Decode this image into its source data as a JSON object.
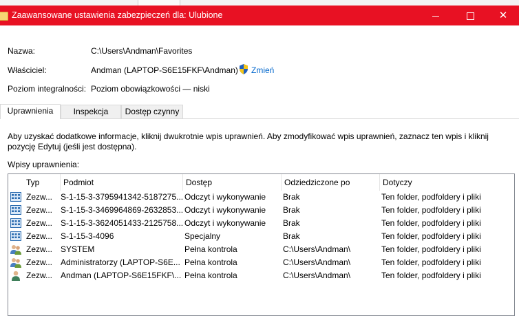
{
  "window": {
    "title": "Zaawansowane ustawienia zabezpieczeń dla: Ulubione"
  },
  "details": {
    "name_label": "Nazwa:",
    "name_value": "C:\\Users\\Andman\\Favorites",
    "owner_label": "Właściciel:",
    "owner_value": "Andman (LAPTOP-S6E15FKF\\Andman)",
    "change_label": "Zmień",
    "integrity_label": "Poziom integralności:",
    "integrity_value": "Poziom obowiązkowości — niski"
  },
  "tabs": [
    {
      "label": "Uprawnienia",
      "active": true
    },
    {
      "label": "Inspekcja",
      "active": false
    },
    {
      "label": "Dostęp czynny",
      "active": false
    }
  ],
  "info_text": "Aby uzyskać dodatkowe informacje, kliknij dwukrotnie wpis uprawnień. Aby zmodyfikować wpis uprawnień, zaznacz ten wpis i kliknij pozycję Edytuj (jeśli jest dostępna).",
  "entries_label": "Wpisy uprawnienia:",
  "table": {
    "columns": [
      "Typ",
      "Podmiot",
      "Dostęp",
      "Odziedziczone po",
      "Dotyczy"
    ],
    "rows": [
      {
        "icon": "app-package-icon",
        "type": "Zezw...",
        "principal": "S-1-15-3-3795941342-5187275...",
        "access": "Odczyt i wykonywanie",
        "inherited": "Brak",
        "applies": "Ten folder, podfoldery i pliki"
      },
      {
        "icon": "app-package-icon",
        "type": "Zezw...",
        "principal": "S-1-15-3-3469964869-2632853...",
        "access": "Odczyt i wykonywanie",
        "inherited": "Brak",
        "applies": "Ten folder, podfoldery i pliki"
      },
      {
        "icon": "app-package-icon",
        "type": "Zezw...",
        "principal": "S-1-15-3-3624051433-2125758...",
        "access": "Odczyt i wykonywanie",
        "inherited": "Brak",
        "applies": "Ten folder, podfoldery i pliki"
      },
      {
        "icon": "app-package-icon",
        "type": "Zezw...",
        "principal": "S-1-15-3-4096",
        "access": "Specjalny",
        "inherited": "Brak",
        "applies": "Ten folder, podfoldery i pliki"
      },
      {
        "icon": "users-group-icon",
        "type": "Zezw...",
        "principal": "SYSTEM",
        "access": "Pełna kontrola",
        "inherited": "C:\\Users\\Andman\\",
        "applies": "Ten folder, podfoldery i pliki"
      },
      {
        "icon": "users-group-icon",
        "type": "Zezw...",
        "principal": "Administratorzy (LAPTOP-S6E...",
        "access": "Pełna kontrola",
        "inherited": "C:\\Users\\Andman\\",
        "applies": "Ten folder, podfoldery i pliki"
      },
      {
        "icon": "user-icon",
        "type": "Zezw...",
        "principal": "Andman (LAPTOP-S6E15FKF\\...",
        "access": "Pełna kontrola",
        "inherited": "C:\\Users\\Andman\\",
        "applies": "Ten folder, podfoldery i pliki"
      }
    ]
  },
  "colors": {
    "titlebar": "#e81123",
    "link": "#0066cc"
  }
}
